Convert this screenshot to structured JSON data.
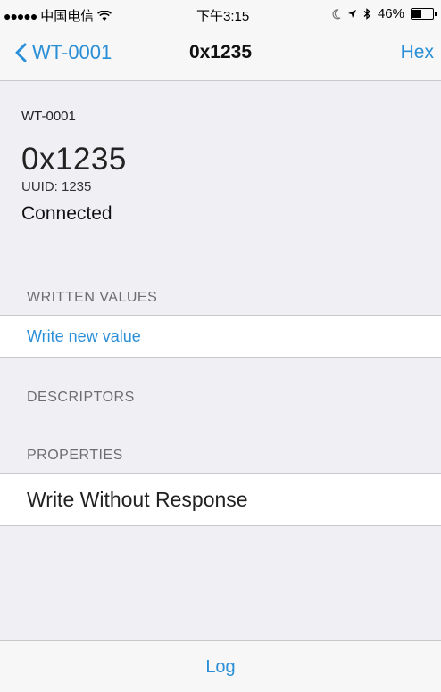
{
  "status_bar": {
    "signal": "●●●●●",
    "carrier": "中国电信",
    "wifi_icon": "wifi-icon",
    "time": "下午3:15",
    "moon_icon": "moon-icon",
    "location_icon": "location-arrow-icon",
    "bluetooth_icon": "bluetooth-icon",
    "battery_percent": "46%",
    "battery_level": 0.46
  },
  "nav": {
    "back_label": "WT-0001",
    "title": "0x1235",
    "hex_label": "Hex"
  },
  "info": {
    "device_name": "WT-0001",
    "characteristic": "0x1235",
    "uuid": "UUID: 1235",
    "status": "Connected"
  },
  "sections": {
    "written_values": "WRITTEN VALUES",
    "write_new_value": "Write new value",
    "descriptors": "DESCRIPTORS",
    "properties": "PROPERTIES",
    "property_item": "Write Without Response"
  },
  "toolbar": {
    "log_label": "Log"
  },
  "colors": {
    "accent": "#2a8fd6",
    "background": "#efeff4"
  }
}
